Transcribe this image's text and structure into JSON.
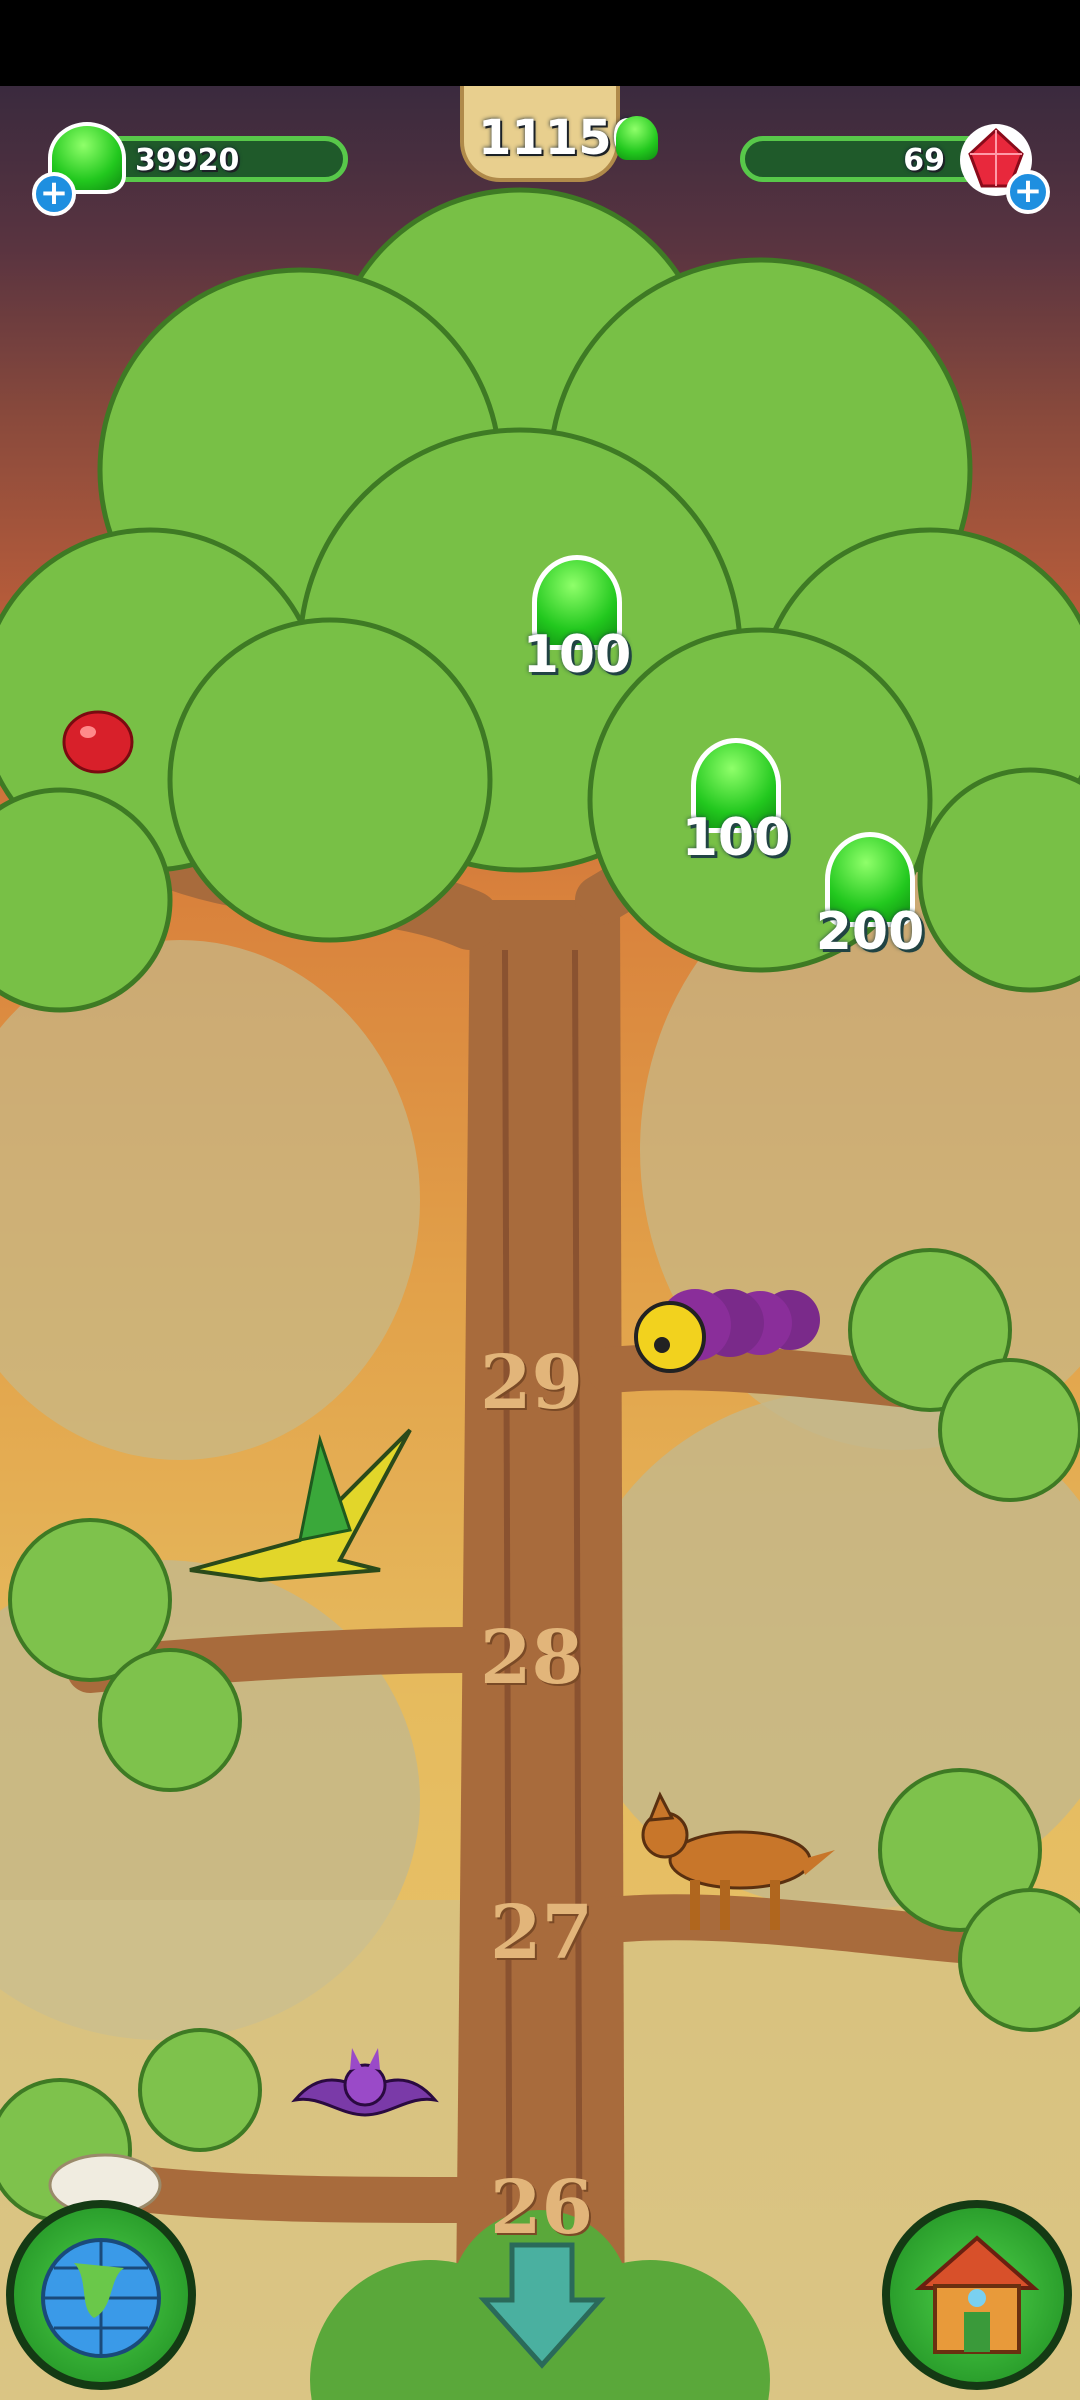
{
  "hud": {
    "jelly_count": "39920",
    "center_score": "11150",
    "gem_count": "69"
  },
  "rewards": [
    {
      "value": "100"
    },
    {
      "value": "100"
    },
    {
      "value": "200"
    }
  ],
  "levels": [
    "29",
    "28",
    "27",
    "26"
  ],
  "icons": {
    "jelly": "green-jelly-icon",
    "gem": "red-gem-icon",
    "add": "plus-icon",
    "map": "globe-icon",
    "home": "house-icon",
    "scroll": "down-arrow-icon"
  },
  "colors": {
    "jelly_green": "#22c81e",
    "plus_blue": "#1e8fe0",
    "bark": "#a86b3c"
  }
}
